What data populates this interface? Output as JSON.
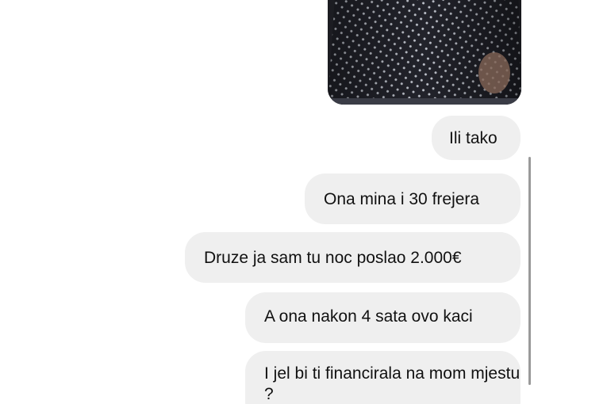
{
  "conversation": {
    "messages": [
      {
        "text": "Ili tako"
      },
      {
        "text": "Ona mina i 30 frejera"
      },
      {
        "text": "Druze ja sam tu noc poslao 2.000€"
      },
      {
        "text": "A ona nakon 4 sata ovo kaci"
      },
      {
        "text": "I jel bi ti financirala na mom mjestu ?"
      }
    ]
  }
}
